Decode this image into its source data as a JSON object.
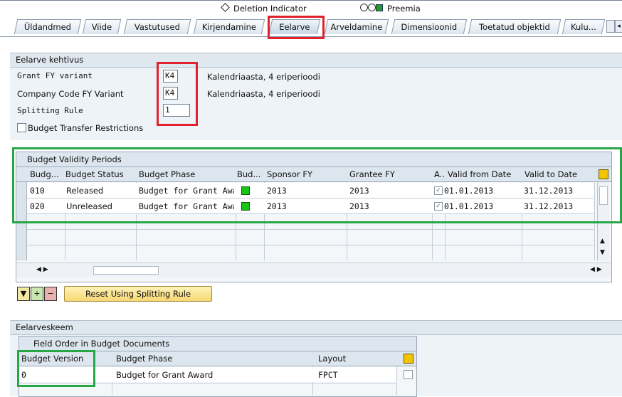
{
  "status_strip": {
    "deletion_indicator": "Deletion Indicator",
    "preemia": "Preemia"
  },
  "tabs": [
    {
      "label": "Üldandmed"
    },
    {
      "label": "Viide"
    },
    {
      "label": "Vastutused"
    },
    {
      "label": "Kirjendamine"
    },
    {
      "label": "Eelarve"
    },
    {
      "label": "Arveldamine"
    },
    {
      "label": "Dimensioonid"
    },
    {
      "label": "Toetatud objektid"
    },
    {
      "label": "Kulu..."
    }
  ],
  "budget_validity": {
    "section_title": "Eelarve kehtivus",
    "grant_fy_label": "Grant FY variant",
    "grant_fy_value": "K4",
    "grant_fy_desc": "Kalendriaasta, 4 eriperioodi",
    "cc_fy_label": "Company Code  FY Variant",
    "cc_fy_value": "K4",
    "cc_fy_desc": "Kalendriaasta, 4 eriperioodi",
    "splitting_label": "Splitting Rule",
    "splitting_value": "1",
    "transfer_label": "Budget Transfer Restrictions"
  },
  "periods_table": {
    "title": "Budget Validity Periods",
    "headers": [
      "Budg...",
      "Budget Status",
      "Budget Phase",
      "Bud...",
      "Sponsor FY",
      "Grantee FY",
      "A..",
      "Valid from Date",
      "Valid to Date"
    ],
    "rows": [
      {
        "budg": "010",
        "status": "Released",
        "phase": "Budget for Grant Awa...",
        "sponsor_fy": "2013",
        "grantee_fy": "2013",
        "checked": true,
        "from": "01.01.2013",
        "to": "31.12.2013"
      },
      {
        "budg": "020",
        "status": "Unreleased",
        "phase": "Budget for Grant Awa...",
        "sponsor_fy": "2013",
        "grantee_fy": "2013",
        "checked": true,
        "from": "01.01.2013",
        "to": "31.12.2013"
      }
    ]
  },
  "reset_button": "Reset Using Splitting Rule",
  "scheme": {
    "section_title": "Eelarveskeem",
    "table_title": "Field Order in Budget Documents",
    "headers": [
      "Budget Version",
      "Budget Phase",
      "Layout"
    ],
    "rows": [
      {
        "version": "0",
        "phase": "Budget for Grant Award",
        "layout": "FPCT"
      }
    ]
  },
  "colors": {
    "highlight_red": "#e0212e",
    "highlight_green": "#27a645",
    "status_green": "#19c419"
  }
}
